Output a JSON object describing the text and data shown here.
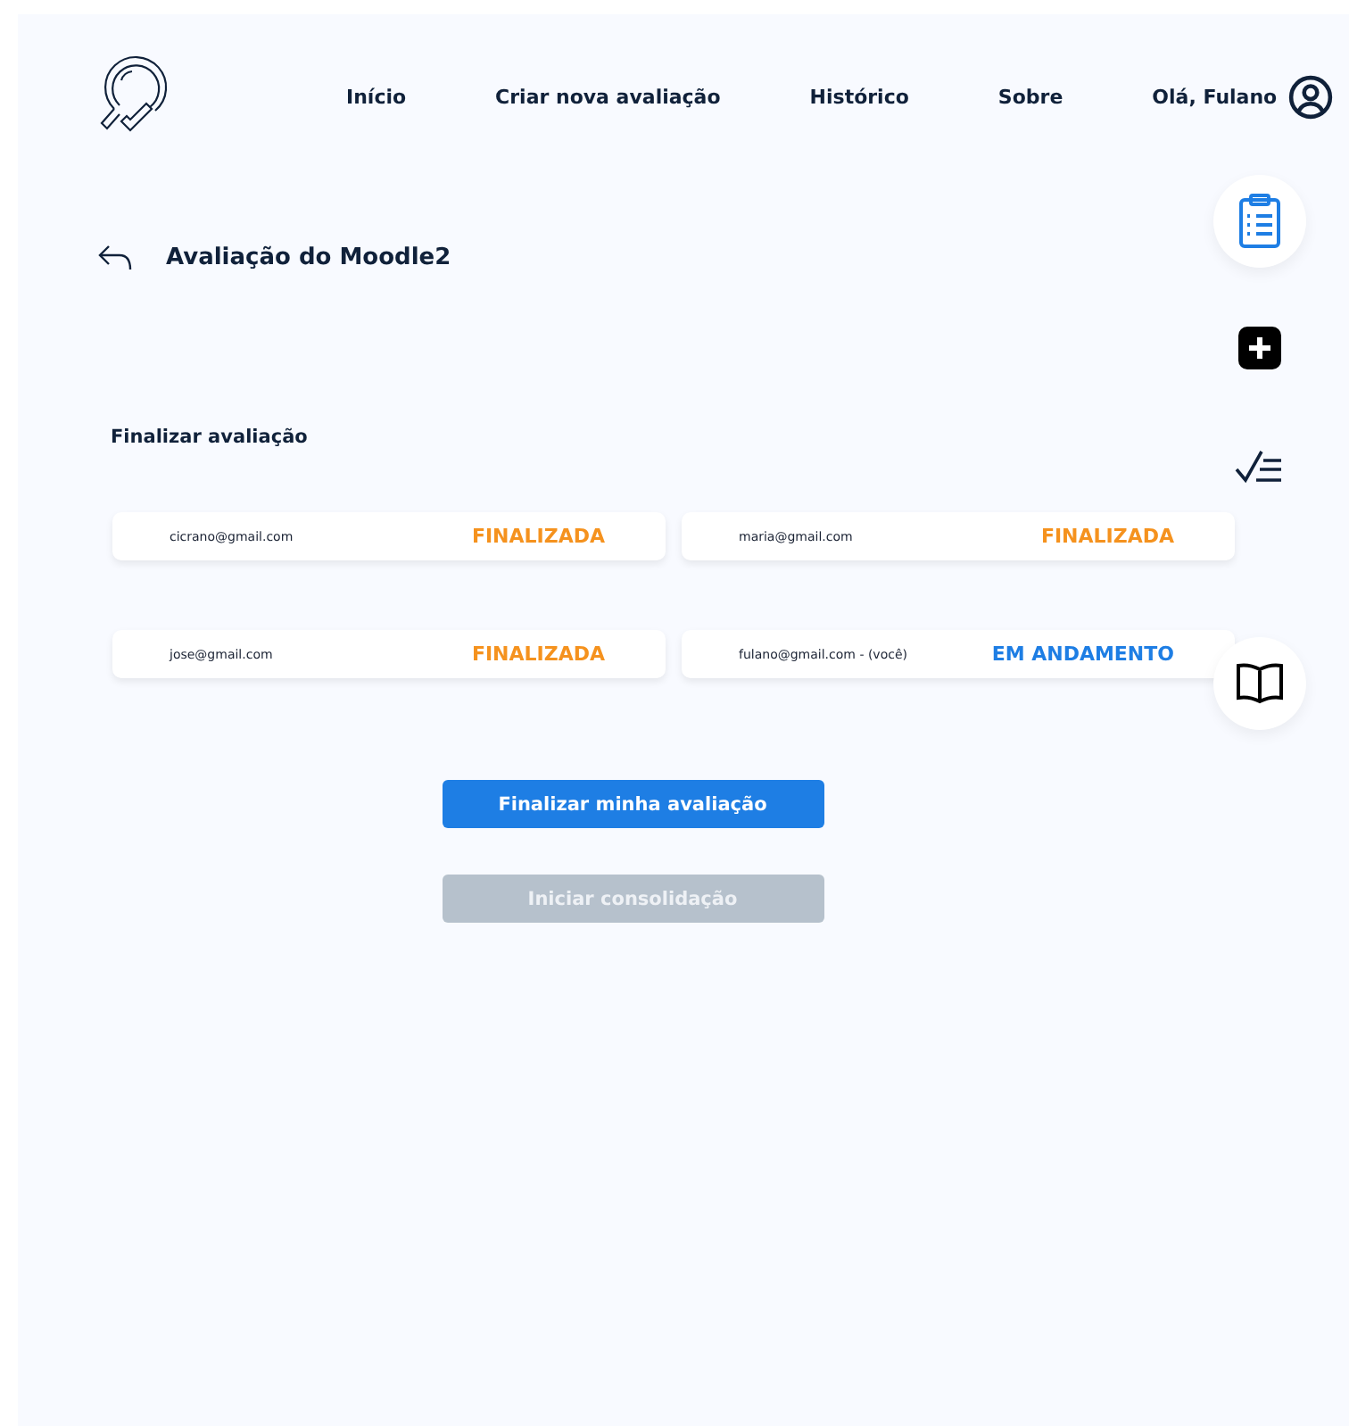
{
  "nav": {
    "links": [
      {
        "label": "Início"
      },
      {
        "label": "Criar nova avaliação"
      },
      {
        "label": "Histórico"
      },
      {
        "label": "Sobre"
      }
    ],
    "greeting": "Olá, Fulano"
  },
  "page": {
    "title": "Avaliação do Moodle2",
    "section": "Finalizar avaliação"
  },
  "participants": [
    {
      "email": "cicrano@gmail.com",
      "status": "FINALIZADA",
      "kind": "done"
    },
    {
      "email": "maria@gmail.com",
      "status": "FINALIZADA",
      "kind": "done"
    },
    {
      "email": "jose@gmail.com",
      "status": "FINALIZADA",
      "kind": "done"
    },
    {
      "email": "fulano@gmail.com - (você)",
      "status": "EM ANDAMENTO",
      "kind": "progress"
    }
  ],
  "buttons": [
    {
      "label": "Finalizar minha avaliação",
      "disabled": false
    },
    {
      "label": "Iniciar consolidação",
      "disabled": true
    }
  ]
}
